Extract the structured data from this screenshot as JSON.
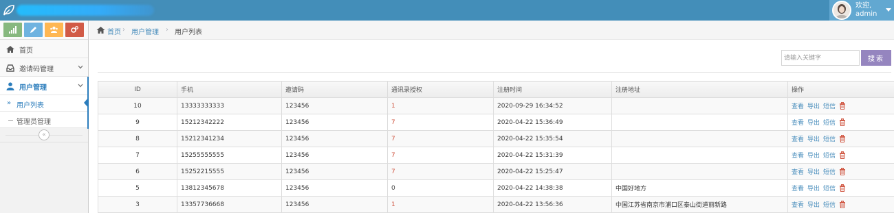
{
  "header": {
    "welcome": "欢迎,",
    "username": "admin"
  },
  "colors": {
    "navbar": "#438eb9",
    "user_box": "#62a8d1",
    "shortcut_green": "#87b87f",
    "shortcut_blue": "#6fb3e0",
    "shortcut_orange": "#ffb752",
    "shortcut_red": "#d15b47",
    "search_button": "#9585bf",
    "link": "#4c8fbd",
    "auth_highlight": "#d15b47"
  },
  "shortcuts": [
    {
      "icon": "signal-icon"
    },
    {
      "icon": "pencil-icon"
    },
    {
      "icon": "users-icon"
    },
    {
      "icon": "cogs-icon"
    }
  ],
  "sidebar": {
    "items": [
      {
        "label": "首页",
        "icon": "home-icon"
      },
      {
        "label": "邀请码管理",
        "icon": "inbox-icon"
      },
      {
        "label": "用户管理",
        "icon": "user-icon"
      }
    ],
    "subitems": [
      {
        "label": "用户列表"
      },
      {
        "label": "管理员管理"
      }
    ],
    "collapse": "«"
  },
  "breadcrumb": {
    "home": "首页",
    "sep": "›",
    "middle": "用户管理",
    "current": "用户列表"
  },
  "search": {
    "placeholder": "请输入关键字",
    "button": "搜索"
  },
  "table": {
    "columns": [
      "ID",
      "手机",
      "邀请码",
      "通讯录授权",
      "注册时间",
      "注册地址",
      "操作"
    ],
    "actions": [
      "查看",
      "导出",
      "短信"
    ],
    "rows": [
      {
        "id": "10",
        "phone": "13333333333",
        "invite": "123456",
        "auth": "1",
        "time": "2020-09-29 16:34:52",
        "address": ""
      },
      {
        "id": "9",
        "phone": "15212342222",
        "invite": "123456",
        "auth": "7",
        "time": "2020-04-22 15:36:49",
        "address": ""
      },
      {
        "id": "8",
        "phone": "15212341234",
        "invite": "123456",
        "auth": "7",
        "time": "2020-04-22 15:35:54",
        "address": ""
      },
      {
        "id": "7",
        "phone": "15255555555",
        "invite": "123456",
        "auth": "7",
        "time": "2020-04-22 15:31:39",
        "address": ""
      },
      {
        "id": "6",
        "phone": "15252215555",
        "invite": "123456",
        "auth": "7",
        "time": "2020-04-22 15:25:47",
        "address": ""
      },
      {
        "id": "5",
        "phone": "13812345678",
        "invite": "123456",
        "auth": "0",
        "time": "2020-04-22 14:38:38",
        "address": "中国好地方"
      },
      {
        "id": "3",
        "phone": "13357736668",
        "invite": "123456",
        "auth": "1",
        "time": "2020-04-22 13:56:36",
        "address": "中国江苏省南京市浦口区泰山街道丽新路"
      }
    ]
  }
}
